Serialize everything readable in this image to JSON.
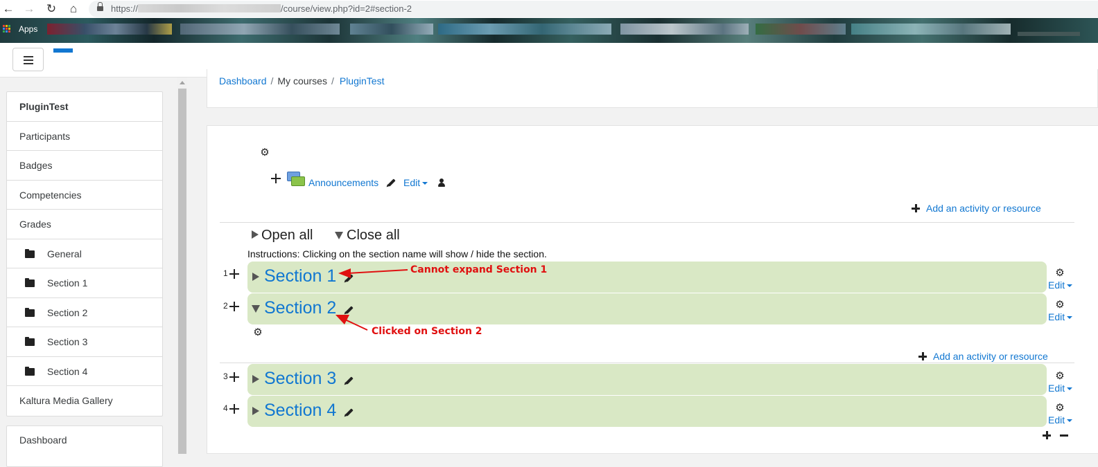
{
  "browser": {
    "url_prefix": "https://",
    "url_suffix": "/course/view.php?id=2#section-2",
    "bookmarks_label": "Apps"
  },
  "drawer": {
    "items": [
      {
        "label": "PluginTest"
      },
      {
        "label": "Participants"
      },
      {
        "label": "Badges"
      },
      {
        "label": "Competencies"
      },
      {
        "label": "Grades"
      },
      {
        "label": "General"
      },
      {
        "label": "Section 1"
      },
      {
        "label": "Section 2"
      },
      {
        "label": "Section 3"
      },
      {
        "label": "Section 4"
      },
      {
        "label": "Kaltura Media Gallery"
      }
    ],
    "dashboard_label": "Dashboard"
  },
  "breadcrumb": {
    "dashboard": "Dashboard",
    "my_courses": "My courses",
    "course": "PluginTest",
    "separator": "/"
  },
  "general": {
    "announcements": "Announcements",
    "edit_label": "Edit",
    "add_activity": "Add an activity or resource"
  },
  "toggles": {
    "open_all": "Open all",
    "close_all": "Close all",
    "instructions": "Instructions: Clicking on the section name will show / hide the section."
  },
  "sections": [
    {
      "number": "1",
      "title": "Section 1",
      "edit": "Edit"
    },
    {
      "number": "2",
      "title": "Section 2",
      "edit": "Edit"
    },
    {
      "number": "3",
      "title": "Section 3",
      "edit": "Edit"
    },
    {
      "number": "4",
      "title": "Section 4",
      "edit": "Edit"
    }
  ],
  "section2": {
    "add_activity": "Add an activity or resource"
  },
  "annotations": {
    "note1": "Cannot expand Section 1",
    "note2": "Clicked on Section 2"
  },
  "colors": {
    "link": "#1177d1",
    "section_bg": "#d9e8c5",
    "annotation": "#e01010"
  }
}
